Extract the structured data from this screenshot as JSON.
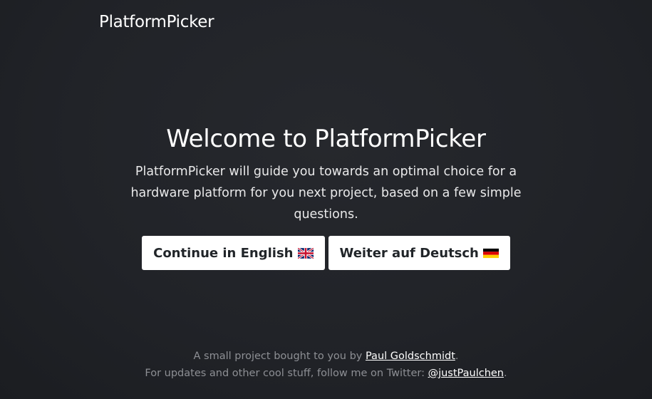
{
  "header": {
    "brand": "PlatformPicker"
  },
  "hero": {
    "title": "Welcome to PlatformPicker",
    "description": "PlatformPicker will guide you towards an optimal choice for a hardware platform for you next project, based on a few simple questions.",
    "buttons": [
      {
        "label": "Continue in English",
        "flag_icon": "uk-flag-icon"
      },
      {
        "label": "Weiter auf Deutsch",
        "flag_icon": "german-flag-icon"
      }
    ]
  },
  "footer": {
    "line1_prefix": "A small project bought to you by ",
    "line1_link": "Paul Goldschmidt",
    "line1_suffix": ".",
    "line2_prefix": "For updates and other cool stuff, follow me on Twitter: ",
    "line2_link": "@justPaulchen",
    "line2_suffix": "."
  },
  "colors": {
    "background": "#212328",
    "button_bg": "#ffffff",
    "button_text": "#212529",
    "footer_text": "#8d8f94"
  }
}
